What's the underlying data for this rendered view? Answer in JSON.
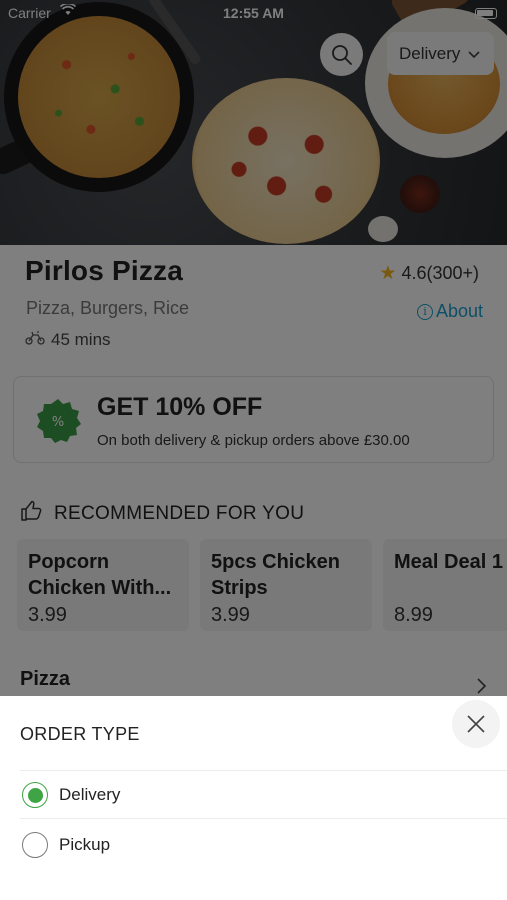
{
  "status_bar": {
    "carrier": "Carrier",
    "time": "12:55 AM"
  },
  "header": {
    "delivery_select": "Delivery"
  },
  "restaurant": {
    "name": "Pirlos Pizza",
    "rating": "4.6(300+)",
    "cuisines": "Pizza, Burgers, Rice",
    "about_label": "About",
    "delivery_time": "45 mins"
  },
  "promo": {
    "title": "GET 10% OFF",
    "description": "On both delivery & pickup orders above £30.00",
    "badge_color": "#3a9a45"
  },
  "recommended": {
    "heading": "RECOMMENDED FOR YOU",
    "items": [
      {
        "name": "Popcorn Chicken With...",
        "price": "3.99"
      },
      {
        "name": "5pcs Chicken Strips",
        "price": "3.99"
      },
      {
        "name": "Meal Deal 1",
        "price": "8.99"
      }
    ]
  },
  "category": {
    "name": "Pizza"
  },
  "order_type_sheet": {
    "title": "ORDER TYPE",
    "options": [
      {
        "label": "Delivery",
        "selected": true
      },
      {
        "label": "Pickup",
        "selected": false
      }
    ],
    "accent_color": "#3fa446"
  }
}
